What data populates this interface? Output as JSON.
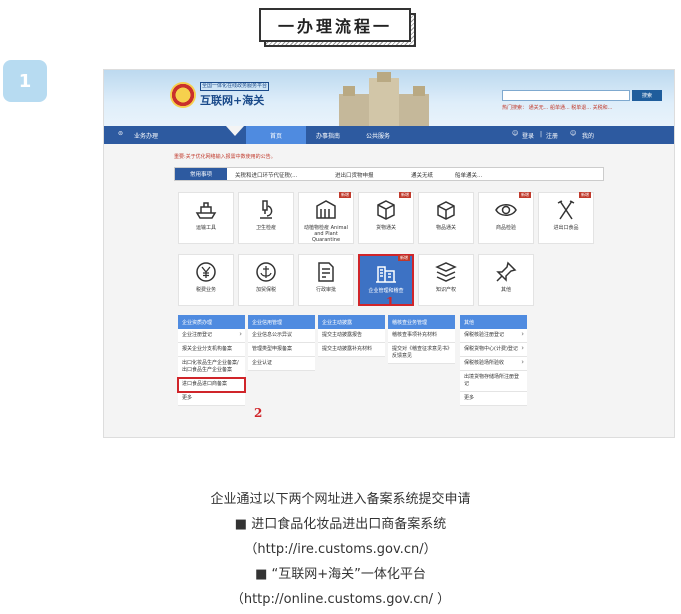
{
  "section_title": "一办理流程一",
  "step_number": "1",
  "site": {
    "logo_small": "全国一体化在线政务服务平台",
    "logo_main": "互联网+海关",
    "search_button": "搜索",
    "hot_links": "热门搜索：   通关无...   船单通...   税单退...   关税和..."
  },
  "nav": {
    "business": "业务办理",
    "home": "首页",
    "guide": "办事指南",
    "public": "公共服务",
    "login": "登录",
    "register": "注册",
    "mine": "我的"
  },
  "notice": "重要:关于优化网络输入报需中数使用的公告。",
  "tabs": {
    "active": "常用事项",
    "items": [
      "关税和进口环节代征税(... ",
      "进出口货物申报",
      "通关无纸",
      "船单通关..."
    ]
  },
  "tiles_row1": [
    {
      "label": "运输工具",
      "icon": "ship-icon",
      "tag": ""
    },
    {
      "label": "卫生检疫",
      "icon": "microscope-icon",
      "tag": ""
    },
    {
      "label": "动植物检疫 Animal and Plant Quarantine",
      "icon": "barn-icon",
      "tag": "新增"
    },
    {
      "label": "货物通关",
      "icon": "cube-icon",
      "tag": "新增"
    },
    {
      "label": "物品通关",
      "icon": "box-icon",
      "tag": ""
    },
    {
      "label": "商品检验",
      "icon": "eye-icon",
      "tag": "新增"
    },
    {
      "label": "进出口食品",
      "icon": "cutlery-icon",
      "tag": "新增"
    }
  ],
  "tiles_row2": [
    {
      "label": "税费业务",
      "icon": "yen-icon",
      "tag": ""
    },
    {
      "label": "加贸保税",
      "icon": "anchor-icon",
      "tag": ""
    },
    {
      "label": "行政审批",
      "icon": "approval-icon",
      "tag": ""
    },
    {
      "label": "企业管理和稽查",
      "icon": "building-icon",
      "tag": "新增"
    },
    {
      "label": "知识产权",
      "icon": "layers-icon",
      "tag": ""
    },
    {
      "label": "其他",
      "icon": "pin-icon",
      "tag": ""
    }
  ],
  "marker1": "1",
  "marker2": "2",
  "menus": [
    {
      "head": "企业资质办理",
      "items": [
        "企业注册登记",
        "报关企业分支机构备案",
        "出口化妆品生产企业备案/出口食品生产企业备案",
        "进口食品进口商备案",
        "更多"
      ]
    },
    {
      "head": "企业信用管理",
      "items": [
        "企业信息公示异议",
        "管理类型申报备案",
        "企业认证"
      ]
    },
    {
      "head": "企业主动披露",
      "items": [
        "提交主动披露报告",
        "提交主动披露补充材料"
      ]
    },
    {
      "head": "稽核查业务管理",
      "items": [
        "稽核查事项补充材料",
        "提交对《稽查征求意见书》反馈意见"
      ]
    },
    {
      "head": "其他",
      "items": [
        "保税核验注册登记",
        "保税货物中心(计费)登记",
        "保税核验场所验收",
        "出境货物存储场所注册登记",
        "更多"
      ]
    }
  ],
  "caption": {
    "line1": "企业通过以下两个网址进入备案系统提交申请",
    "line2": "■ 进口食品化妆品进出口商备案系统",
    "line3": "（http://ire.customs.gov.cn/）",
    "line4": "■ “互联网+海关”一体化平台",
    "line5": "（http://online.customs.gov.cn/ ）"
  }
}
